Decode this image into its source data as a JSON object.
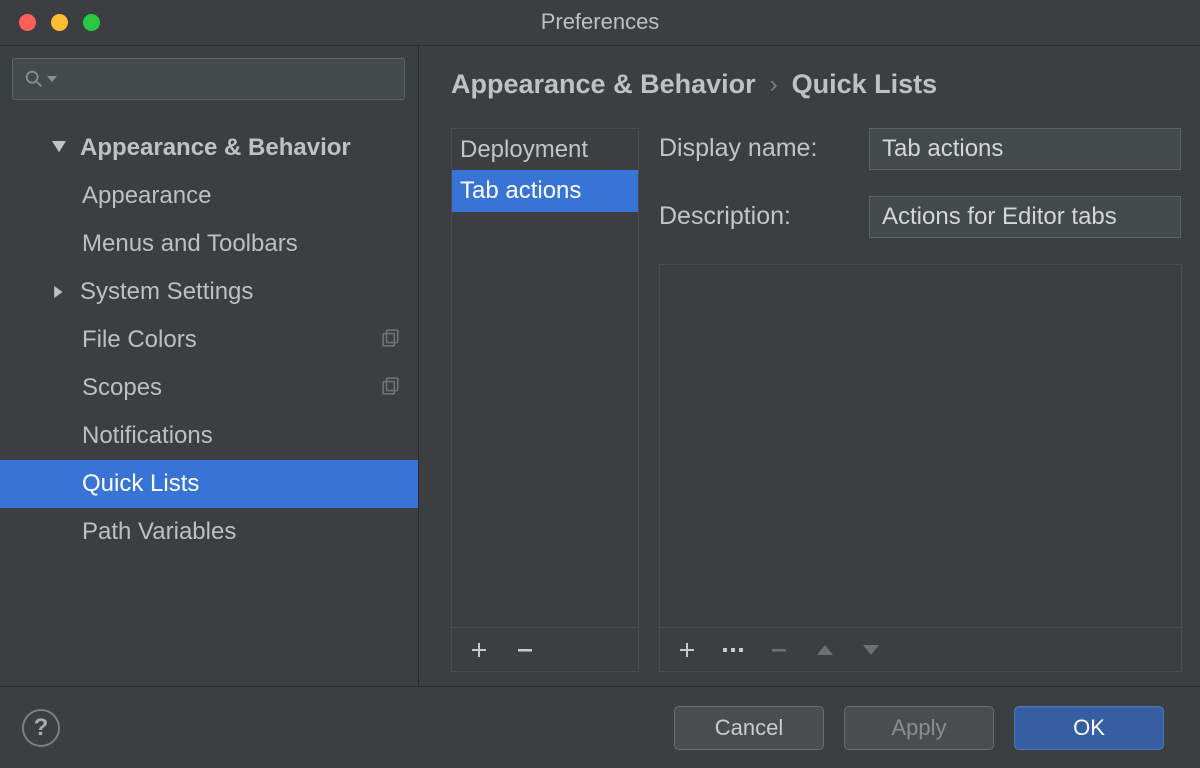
{
  "window": {
    "title": "Preferences"
  },
  "search": {
    "placeholder": ""
  },
  "nav": {
    "category": "Appearance & Behavior",
    "items": [
      {
        "label": "Appearance",
        "expandable": false,
        "icon": null
      },
      {
        "label": "Menus and Toolbars",
        "expandable": false,
        "icon": null
      },
      {
        "label": "System Settings",
        "expandable": true,
        "icon": null
      },
      {
        "label": "File Colors",
        "expandable": false,
        "icon": "project"
      },
      {
        "label": "Scopes",
        "expandable": false,
        "icon": "project"
      },
      {
        "label": "Notifications",
        "expandable": false,
        "icon": null
      },
      {
        "label": "Quick Lists",
        "expandable": false,
        "icon": null,
        "selected": true
      },
      {
        "label": "Path Variables",
        "expandable": false,
        "icon": null
      }
    ]
  },
  "breadcrumbs": {
    "a": "Appearance & Behavior",
    "b": "Quick Lists"
  },
  "quick_lists": {
    "items": [
      {
        "label": "Deployment",
        "selected": false
      },
      {
        "label": "Tab actions",
        "selected": true
      }
    ]
  },
  "form": {
    "display_name_label": "Display name:",
    "display_name_value": "Tab actions",
    "description_label": "Description:",
    "description_value": "Actions for Editor tabs"
  },
  "footer": {
    "cancel": "Cancel",
    "apply": "Apply",
    "ok": "OK"
  }
}
